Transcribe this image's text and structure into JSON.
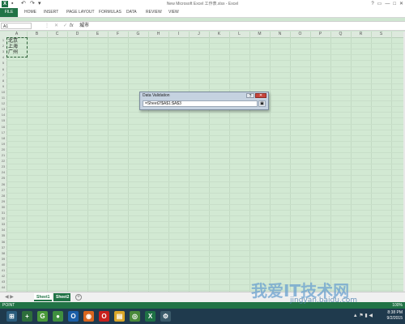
{
  "window": {
    "title": "New Microsoft Excel 工作表.xlsx - Excel",
    "app_icon": "X",
    "qat": [
      "↶",
      "↷",
      "▾"
    ],
    "controls": [
      "?",
      "▭",
      "—",
      "□",
      "✕"
    ]
  },
  "ribbon": {
    "tabs": [
      "FILE",
      "HOME",
      "INSERT",
      "PAGE LAYOUT",
      "FORMULAS",
      "DATA",
      "REVIEW",
      "VIEW"
    ]
  },
  "formula_bar": {
    "name_box": "A1",
    "fx_label": "fx",
    "value": "城市"
  },
  "grid": {
    "columns": [
      "A",
      "B",
      "C",
      "D",
      "E",
      "F",
      "G",
      "H",
      "I",
      "J",
      "K",
      "L",
      "M",
      "N",
      "O",
      "P",
      "Q",
      "R",
      "S"
    ],
    "rows": [
      "1",
      "2",
      "3",
      "4",
      "5",
      "6",
      "7",
      "8",
      "9",
      "10",
      "11",
      "12",
      "13",
      "14",
      "15",
      "16",
      "17",
      "18",
      "19",
      "20",
      "21",
      "22",
      "23",
      "24",
      "25",
      "26",
      "27",
      "28",
      "29",
      "30",
      "31",
      "32",
      "33",
      "34",
      "35",
      "36",
      "37",
      "38",
      "39",
      "40",
      "41",
      "42",
      "43",
      "44"
    ],
    "cells": [
      "北京",
      "上海",
      "广州"
    ]
  },
  "dialog": {
    "title": "Data Validation",
    "help": "?",
    "close": "✕",
    "input_value": "=Sheet2!$A$1:$A$3",
    "collapse": "▣"
  },
  "sheets": {
    "nav": "◀ ▶",
    "tabs": [
      "Sheet1",
      "Sheet2"
    ],
    "add": "+"
  },
  "status": {
    "mode": "POINT",
    "zoom": "100%"
  },
  "taskbar": {
    "clock_time": "8:38 PM",
    "clock_date": "9/2/2015",
    "apps": [
      {
        "name": "start",
        "glyph": "⊞",
        "color": "#2b5d7d"
      },
      {
        "name": "add",
        "glyph": "+",
        "color": "#2d6e3b"
      },
      {
        "name": "g-app",
        "glyph": "G",
        "color": "#4a9a3a"
      },
      {
        "name": "green-app",
        "glyph": "●",
        "color": "#3f8f3f"
      },
      {
        "name": "outlook",
        "glyph": "O",
        "color": "#1b5fa8"
      },
      {
        "name": "firefox",
        "glyph": "◉",
        "color": "#d9661e"
      },
      {
        "name": "opera",
        "glyph": "O",
        "color": "#c8201d"
      },
      {
        "name": "folder",
        "glyph": "▤",
        "color": "#d9a628"
      },
      {
        "name": "chrome",
        "glyph": "◎",
        "color": "#4a8a3a"
      },
      {
        "name": "excel",
        "glyph": "X",
        "color": "#1e7145"
      },
      {
        "name": "network",
        "glyph": "⚙",
        "color": "#3a5a6a"
      }
    ],
    "tray": "▲ ⚑ ▮ ◀"
  },
  "watermark": {
    "main": "我爱IT技术网",
    "sub": "jingyan.baidu.com"
  }
}
